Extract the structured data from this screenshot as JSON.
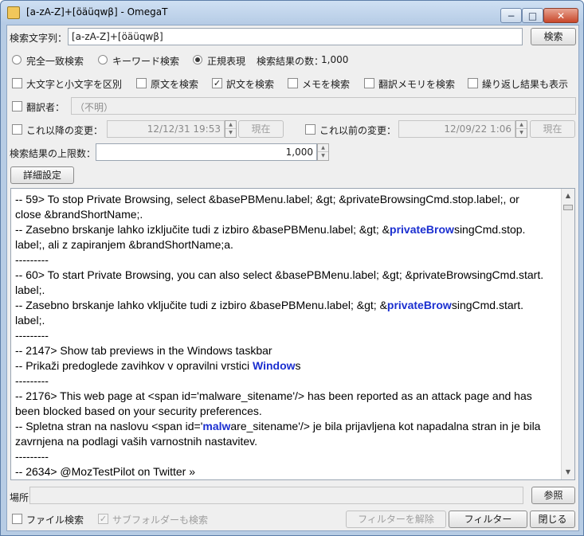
{
  "window": {
    "title": "[a-zA-Z]+[öäüqwβ] - OmegaT",
    "minimize_glyph": "−",
    "maximize_glyph": "□",
    "close_glyph": "✕"
  },
  "search": {
    "label": "検索文字列：",
    "value": "[a-zA-Z]+[öäüqwβ]",
    "button": "検索"
  },
  "mode": {
    "exact": "完全一致検索",
    "keyword": "キーワード検索",
    "regex": "正規表現",
    "selected": "regex",
    "result_count_label": "検索結果の数：",
    "result_count": "1,000"
  },
  "options": [
    {
      "label": "大文字と小文字を区別",
      "checked": false
    },
    {
      "label": "原文を検索",
      "checked": false
    },
    {
      "label": "訳文を検索",
      "checked": true
    },
    {
      "label": "メモを検索",
      "checked": false
    },
    {
      "label": "翻訳メモリを検索",
      "checked": false
    },
    {
      "label": "繰り返し結果も表示",
      "checked": false
    }
  ],
  "translator": {
    "label": "翻訳者：",
    "value": "（不明）"
  },
  "after": {
    "label": "これ以降の変更：",
    "value": "12/12/31 19:53",
    "now_button": "現在"
  },
  "before": {
    "label": "これ以前の変更：",
    "value": "12/09/22 1:06",
    "now_button": "現在"
  },
  "limit": {
    "label": "検索結果の上限数：",
    "value": "1,000"
  },
  "advanced_button": "詳細設定",
  "results": {
    "lines": [
      [
        {
          "t": "-- 59> To stop Private Browsing, select &basePBMenu.label; &gt; &privateBrowsingCmd.stop.label;, or"
        }
      ],
      [
        {
          "t": "close &brandShortName;."
        }
      ],
      [
        {
          "t": "-- Zasebno brskanje lahko izključite tudi z izbiro &basePBMenu.label; &gt; &"
        },
        {
          "t": "privateBrow",
          "h": true
        },
        {
          "t": "singCmd.stop."
        }
      ],
      [
        {
          "t": "label;, ali z zapiranjem &brandShortName;a."
        }
      ],
      [
        {
          "t": "---------"
        }
      ],
      [
        {
          "t": "-- 60> To start Private Browsing, you can also select &basePBMenu.label; &gt; &privateBrowsingCmd.start."
        }
      ],
      [
        {
          "t": "label;."
        }
      ],
      [
        {
          "t": "-- Zasebno brskanje lahko vključite tudi z izbiro &basePBMenu.label; &gt; &"
        },
        {
          "t": "privateBrow",
          "h": true
        },
        {
          "t": "singCmd.start."
        }
      ],
      [
        {
          "t": "label;."
        }
      ],
      [
        {
          "t": "---------"
        }
      ],
      [
        {
          "t": "-- 2147> Show tab previews in the Windows taskbar"
        }
      ],
      [
        {
          "t": "-- Prikaži predoglede zavihkov v opravilni vrstici "
        },
        {
          "t": "Window",
          "h": true
        },
        {
          "t": "s"
        }
      ],
      [
        {
          "t": "---------"
        }
      ],
      [
        {
          "t": "-- 2176> This web page at <span id='malware_sitename'/> has been reported as an attack page and has"
        }
      ],
      [
        {
          "t": "been blocked based on your security preferences."
        }
      ],
      [
        {
          "t": "-- Spletna stran na naslovu <span id='"
        },
        {
          "t": "malw",
          "h": true
        },
        {
          "t": "are_sitename'/> je bila prijavljena kot napadalna stran in je bila"
        }
      ],
      [
        {
          "t": "zavrnjena na podlagi vaših varnostnih nastavitev."
        }
      ],
      [
        {
          "t": "---------"
        }
      ],
      [
        {
          "t": "-- 2634> @MozTestPilot on Twitter »"
        }
      ]
    ]
  },
  "location": {
    "label": "場所",
    "value": "",
    "browse_button": "参照"
  },
  "bottom": {
    "file_search": "ファイル検索",
    "file_search_checked": false,
    "subfolder": "サブフォルダーも検索",
    "subfolder_checked": true,
    "clear_filter": "フィルターを解除",
    "filter": "フィルター",
    "close": "閉じる"
  }
}
